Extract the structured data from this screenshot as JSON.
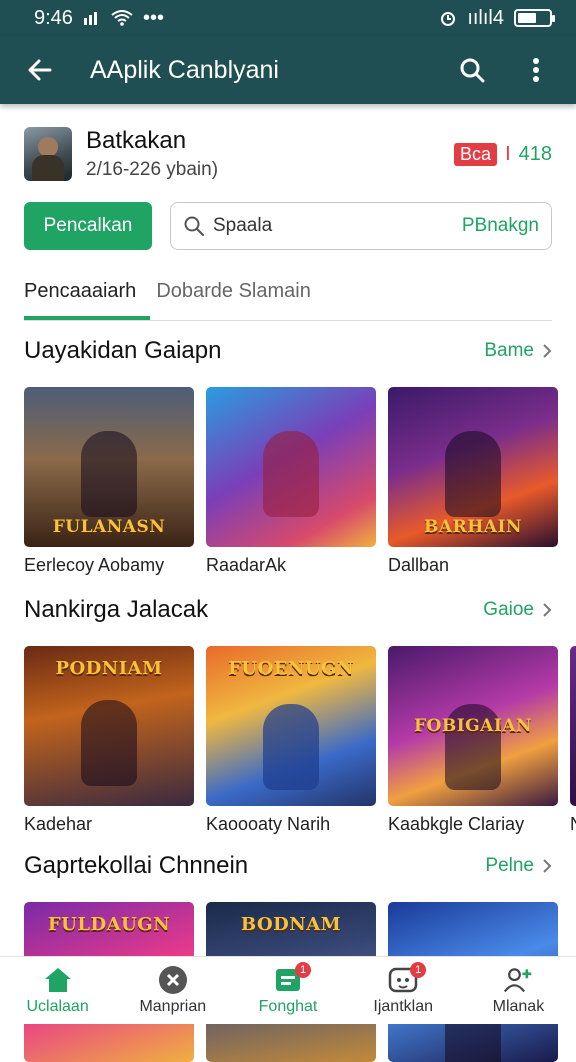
{
  "status_bar": {
    "time": "9:46",
    "signal_text": "ıılıl4",
    "more": "•••"
  },
  "app_bar": {
    "title": "AAplik Canblyani"
  },
  "app": {
    "name": "Batkakan",
    "sub": "2/16-226 ybain)",
    "badge": "Bca",
    "meta_red": "I",
    "meta_green": "418"
  },
  "actions": {
    "primary_label": "Pencalkan",
    "search_placeholder": "Spaala",
    "search_sub": "PBnakgn"
  },
  "tabs": [
    {
      "label": "Pencaaaiarh"
    },
    {
      "label": "Dobarde Slamain"
    }
  ],
  "sections": [
    {
      "title": "Uayakidan Gaiapn",
      "more": "Bame",
      "games": [
        {
          "name": "Eerlecoy Aobamy",
          "logo": "FULANASN"
        },
        {
          "name": "RaadarAk",
          "logo": ""
        },
        {
          "name": "Dallban",
          "logo": "BARHAIN"
        }
      ]
    },
    {
      "title": "Nankirga Jalacak",
      "more": "Gaioe",
      "games": [
        {
          "name": "Kadehar",
          "logo": "PODNIAM"
        },
        {
          "name": "Kaoooaty Narih",
          "logo": "FUOENUGN"
        },
        {
          "name": "Kaabkgle Clariay",
          "logo": "FOBIGAIAN"
        },
        {
          "name": "N",
          "logo": ""
        }
      ]
    },
    {
      "title": "Gaprtekollai Chnnein",
      "more": "Pelne",
      "games": [
        {
          "name": "",
          "logo": "FULDAUGN"
        },
        {
          "name": "",
          "logo": "BODNAM"
        },
        {
          "name": "",
          "logo": ""
        }
      ]
    }
  ],
  "bottom_nav": [
    {
      "label": "Uclalaan",
      "badge": ""
    },
    {
      "label": "Manprian",
      "badge": ""
    },
    {
      "label": "Fonghat",
      "badge": "1"
    },
    {
      "label": "Ijantklan",
      "badge": "1"
    },
    {
      "label": "Mlanak",
      "badge": ""
    }
  ],
  "colors": {
    "header": "#1f4f52",
    "accent": "#1fa463",
    "alert": "#e23c45"
  }
}
